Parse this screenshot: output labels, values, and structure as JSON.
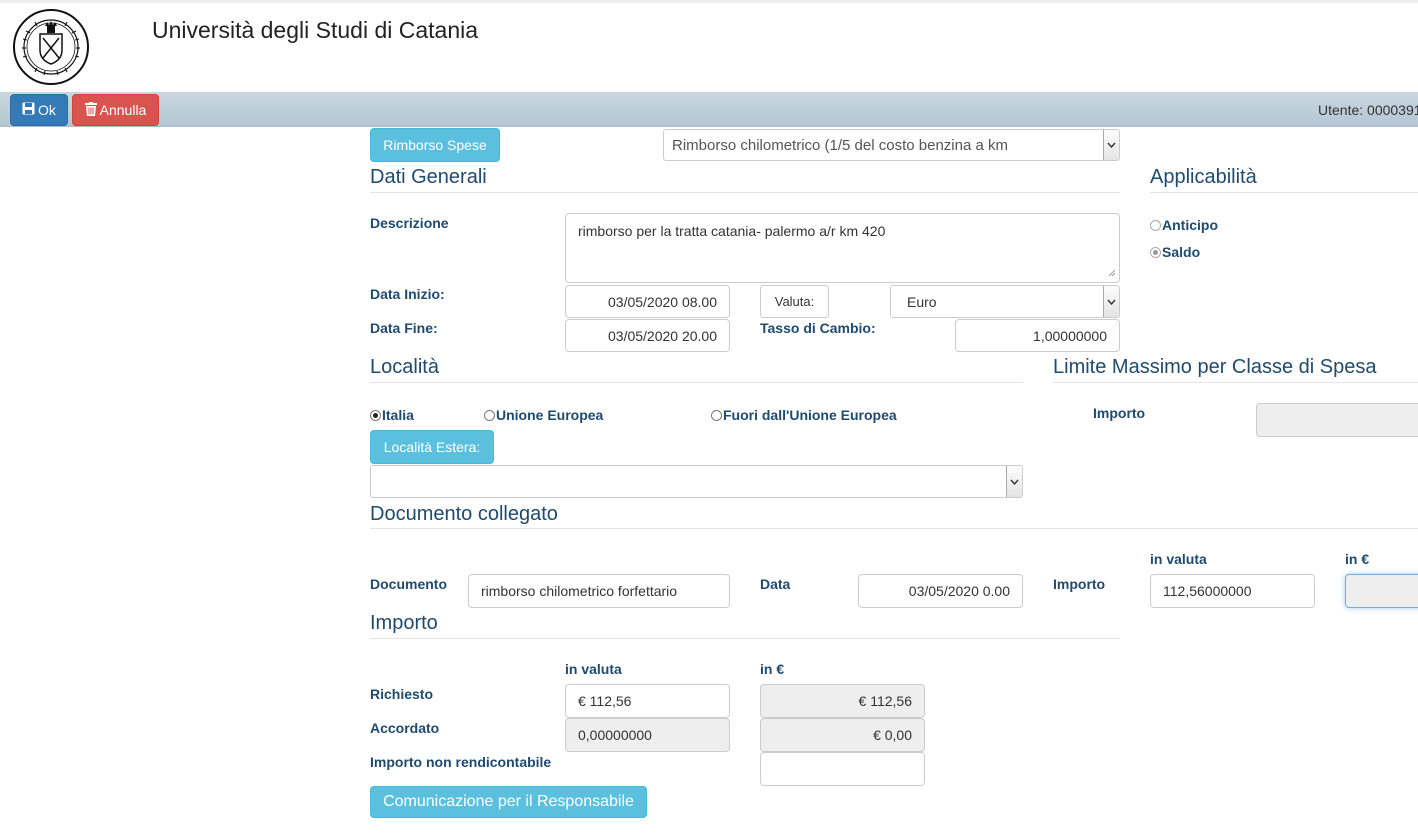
{
  "header": {
    "title": "Università degli Studi di Catania",
    "logo_text": "SICILIAE STVDIVM GENERALE 1434"
  },
  "toolbar": {
    "ok_label": "Ok",
    "annulla_label": "Annulla",
    "utente": "Utente: 0000391"
  },
  "top": {
    "rimborso_button": "Rimborso Spese",
    "rimborso_select": "Rimborso chilometrico (1/5 del costo benzina a km"
  },
  "dati_generali": {
    "title": "Dati Generali",
    "descrizione_label": "Descrizione",
    "descrizione_value": "rimborso per la tratta catania- palermo a/r km 420",
    "data_inizio_label": "Data Inizio:",
    "data_inizio_value": "03/05/2020 08.00",
    "data_fine_label": "Data Fine:",
    "data_fine_value": "03/05/2020 20.00",
    "valuta_label": "Valuta:",
    "valuta_value": "Euro",
    "tasso_label": "Tasso di Cambio:",
    "tasso_value": "1,00000000"
  },
  "applicabilita": {
    "title": "Applicabilità",
    "anticipo": "Anticipo",
    "saldo": "Saldo"
  },
  "localita": {
    "title": "Località",
    "italia": "Italia",
    "unione_europea": "Unione Europea",
    "fuori_ue": "Fuori dall'Unione Europea",
    "estera_button": "Località Estera:",
    "estera_select": ""
  },
  "limite": {
    "title": "Limite Massimo per Classe di Spesa",
    "importo_label": "Importo",
    "importo_value": ""
  },
  "documento": {
    "title": "Documento collegato",
    "documento_label": "Documento",
    "documento_value": "rimborso chilometrico forfettario",
    "data_label": "Data",
    "data_value": "03/05/2020 0.00",
    "importo_label": "Importo",
    "in_valuta_label": "in valuta",
    "in_euro_label": "in €",
    "importo_valuta_value": "112,56000000",
    "importo_euro_value": ""
  },
  "importo": {
    "title": "Importo",
    "in_valuta_label": "in valuta",
    "in_euro_label": "in €",
    "richiesto_label": "Richiesto",
    "richiesto_valuta": "€ 112,56",
    "richiesto_euro": "€ 112,56",
    "accordato_label": "Accordato",
    "accordato_valuta": "0,00000000",
    "accordato_euro": "€ 0,00",
    "non_rendicontabile_label": "Importo non rendicontabile",
    "non_rendicontabile_value": "",
    "comunicazione_button": "Comunicazione per il Responsabile"
  }
}
